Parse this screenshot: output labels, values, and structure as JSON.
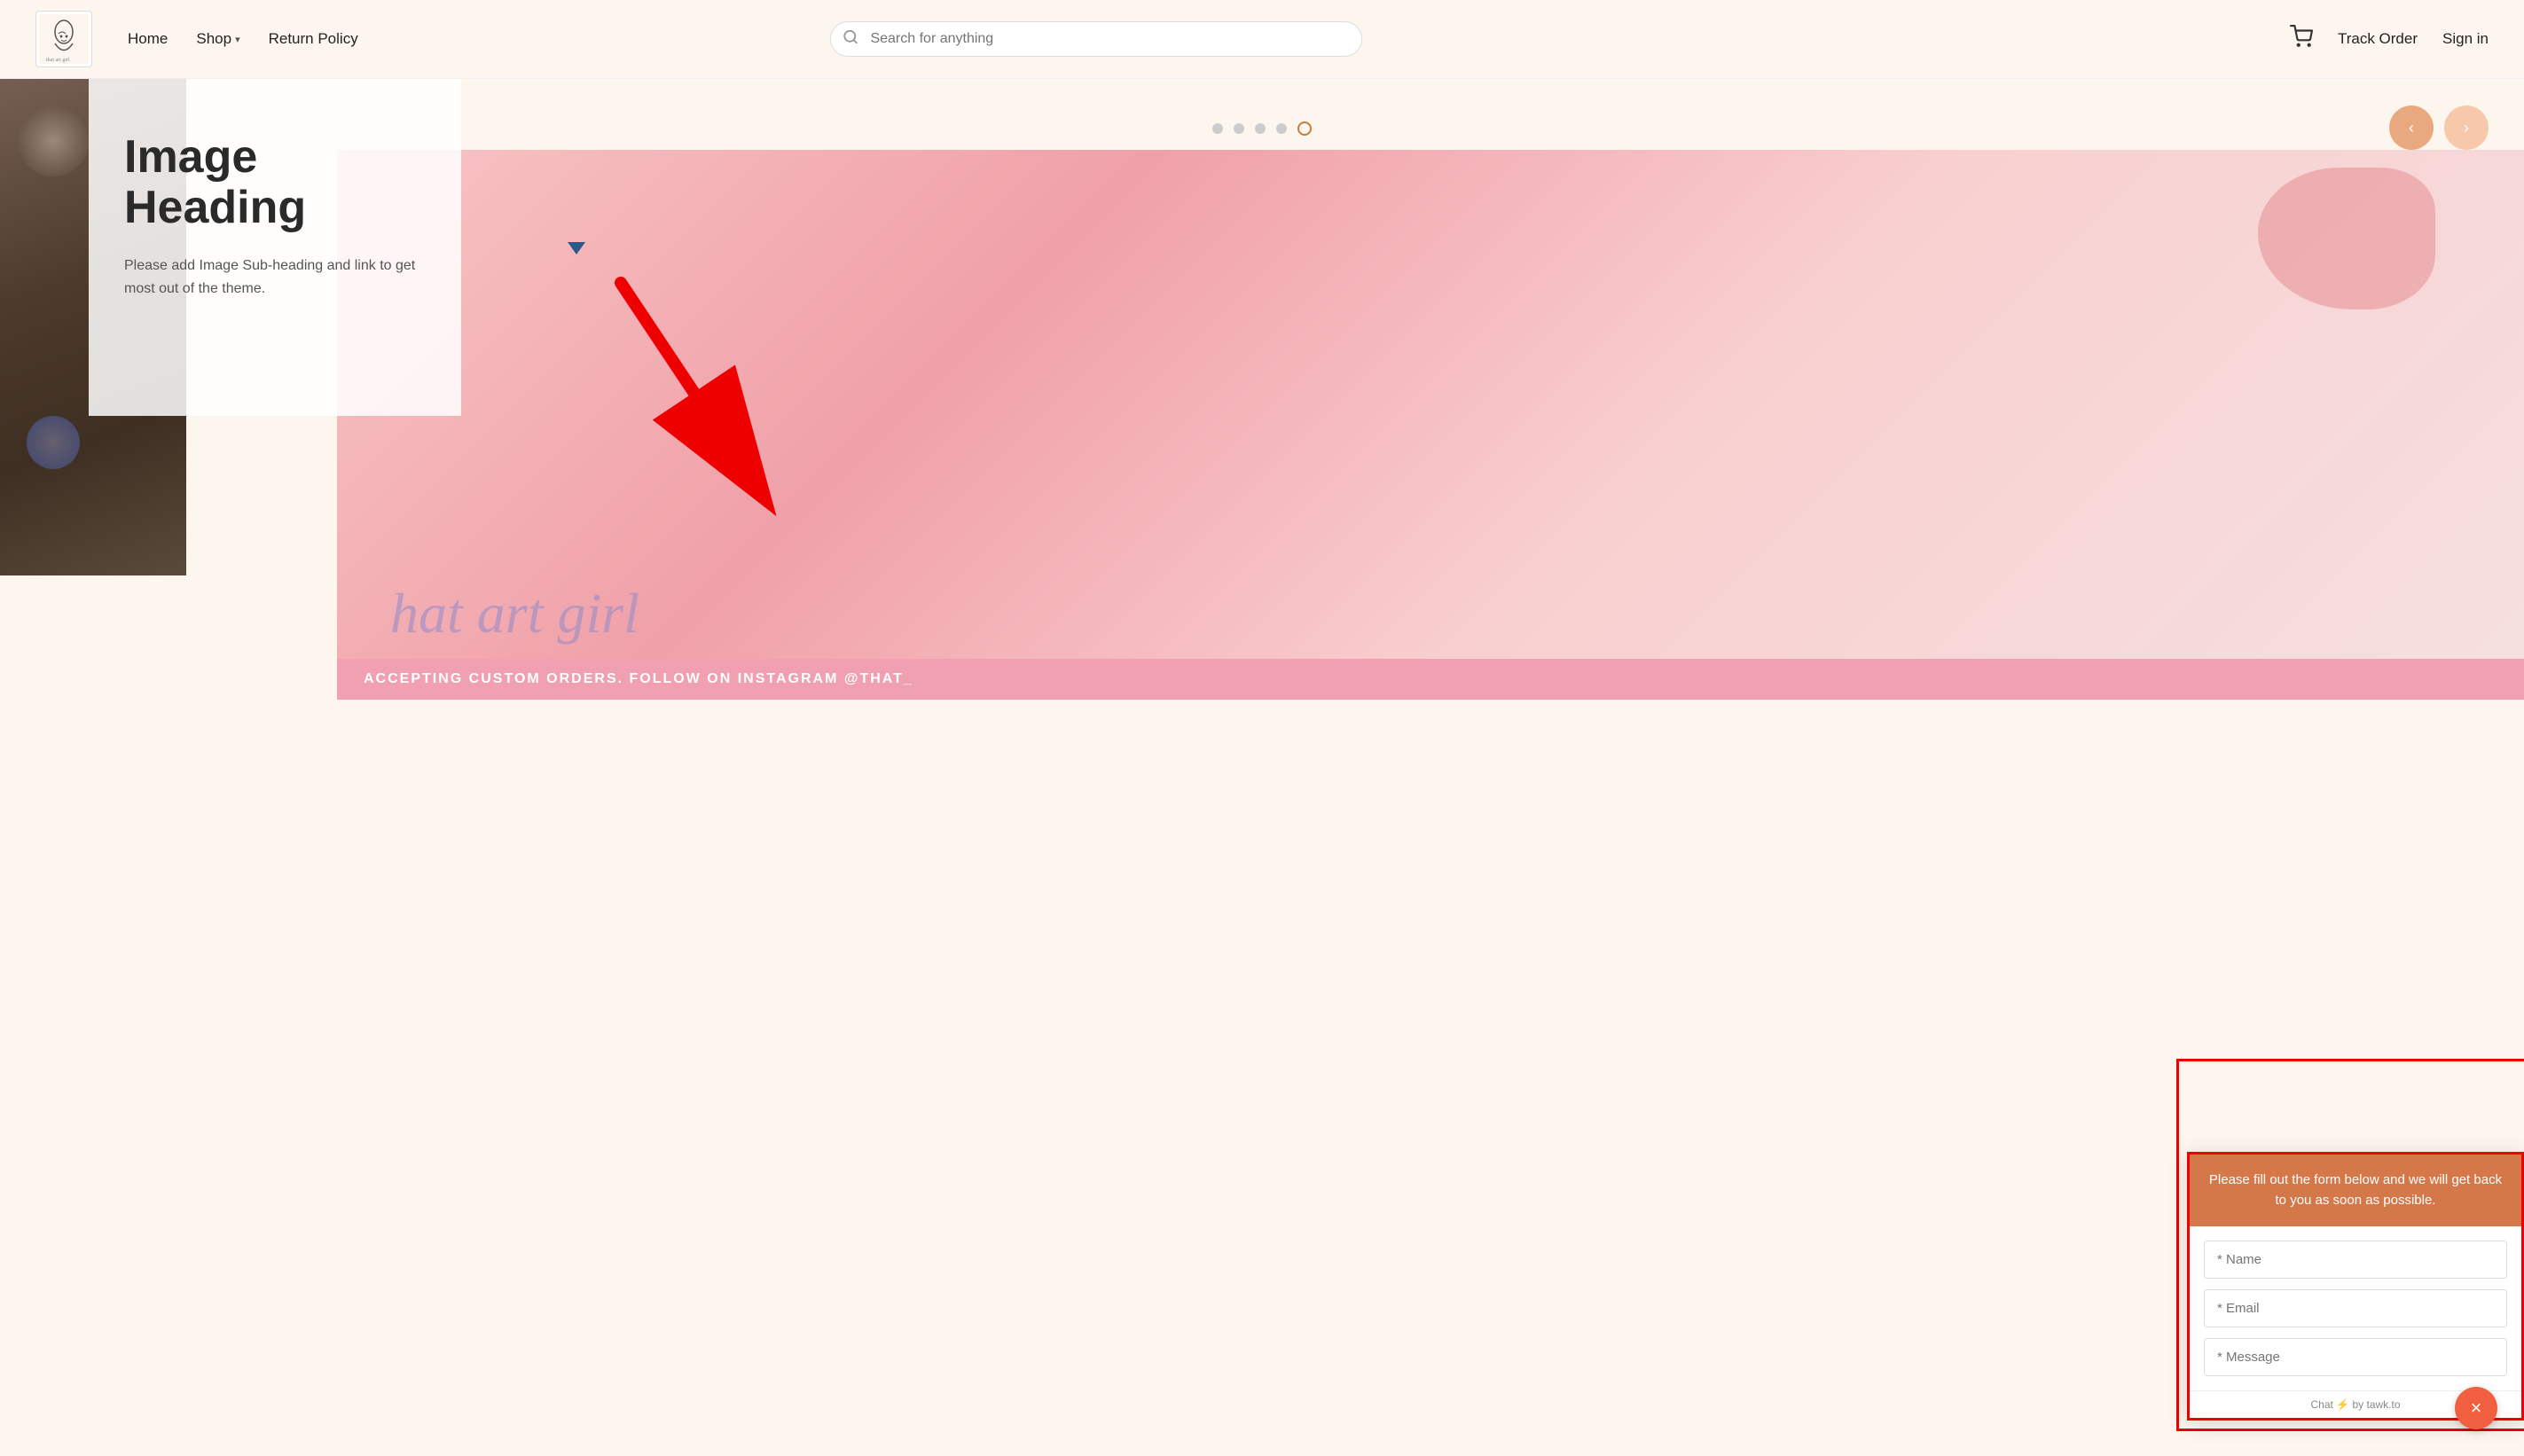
{
  "header": {
    "logo_alt": "That Art Girl",
    "nav": {
      "home_label": "Home",
      "shop_label": "Shop",
      "return_policy_label": "Return Policy"
    },
    "search": {
      "placeholder": "Search for anything"
    },
    "actions": {
      "track_order_label": "Track Order",
      "sign_in_label": "Sign in"
    }
  },
  "slider": {
    "dots": [
      {
        "active": false
      },
      {
        "active": false
      },
      {
        "active": false
      },
      {
        "active": false
      },
      {
        "active": true
      }
    ],
    "prev_label": "‹",
    "next_label": "›"
  },
  "hero": {
    "heading": "Image\nHeading",
    "subheading": "Please add Image Sub-heading and link to get most out of the theme.",
    "script_text": "hat art girl"
  },
  "ticker": {
    "text": "ACCEPTING CUSTOM ORDERS. FOLLOW ON INSTAGRAM @THAT_"
  },
  "chat": {
    "header_text": "Please fill out the form below and we will get back to you as soon as possible.",
    "name_placeholder": "* Name",
    "email_placeholder": "* Email",
    "message_placeholder": "* Message",
    "footer_text": "Chat",
    "footer_suffix": " by tawk.to",
    "close_icon": "×"
  }
}
